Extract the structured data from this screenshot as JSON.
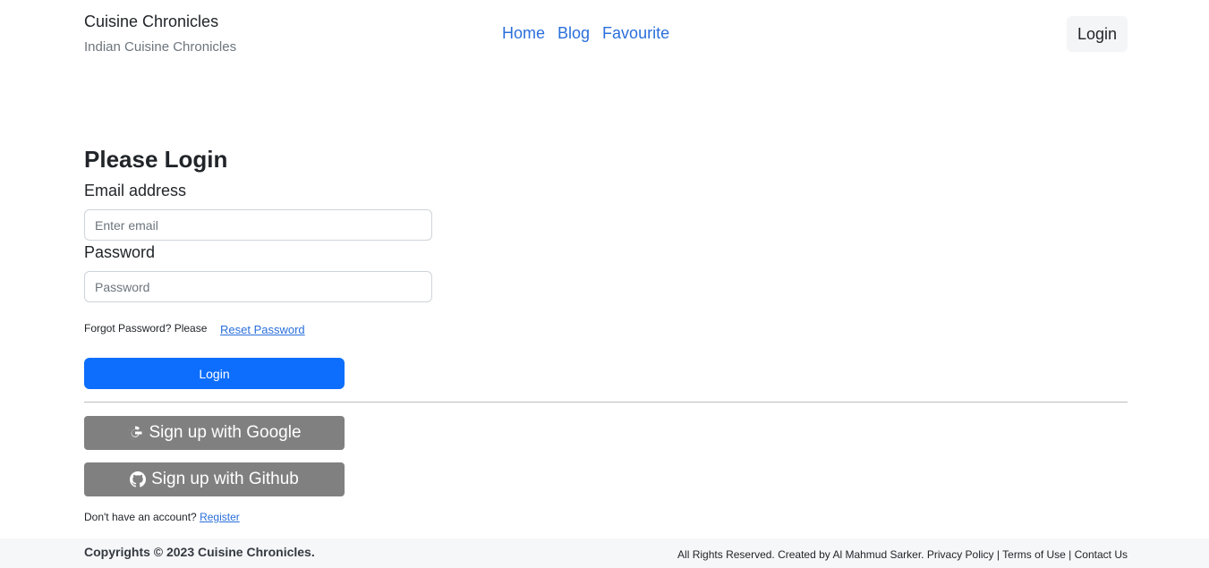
{
  "header": {
    "brand_title": "Cuisine Chronicles",
    "brand_subtitle": "Indian Cuisine Chronicles",
    "nav": [
      {
        "label": "Home"
      },
      {
        "label": "Blog"
      },
      {
        "label": "Favourite"
      }
    ],
    "login_button": "Login"
  },
  "form": {
    "heading": "Please Login",
    "email_label": "Email address",
    "email_placeholder": "Enter email",
    "email_value": "",
    "password_label": "Password",
    "password_placeholder": "Password",
    "password_value": "",
    "forgot_text": "Forgot Password? Please",
    "reset_link": "Reset Password",
    "login_button": "Login"
  },
  "social": {
    "google_label": "Sign up with Google",
    "google_icon": "google-icon",
    "github_label": "Sign up with Github",
    "github_icon": "github-icon"
  },
  "register": {
    "prompt": "Don't have an account?",
    "link": "Register"
  },
  "footer": {
    "copyright": "Copyrights © 2023 Cuisine Chronicles.",
    "credit": "All Rights Reserved. Created by Al Mahmud Sarker.",
    "links": [
      "Privacy Policy",
      "Terms of Use",
      "Contact Us"
    ],
    "separator": "|"
  },
  "colors": {
    "primary": "#0d6efd",
    "link": "#2a6fdb",
    "social_button": "#808080",
    "footer_bg": "#f6f7f9"
  }
}
